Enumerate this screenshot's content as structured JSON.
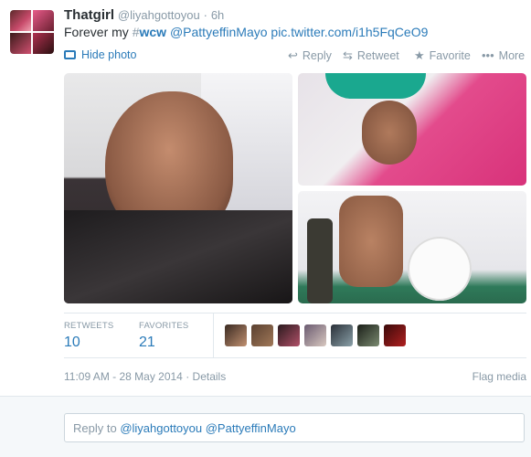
{
  "tweet": {
    "fullname": "Thatgirl",
    "handle": "@liyahgottoyou",
    "separator": "·",
    "time": "6h",
    "text_prefix": "Forever my ",
    "hashtag_hash": "#",
    "hashtag_word": "wcw",
    "mention": "@PattyeffinMayo",
    "link": "pic.twitter.com/i1h5FqCeO9"
  },
  "actions": {
    "hide_photo": "Hide photo",
    "reply": "Reply",
    "retweet": "Retweet",
    "favorite": "Favorite",
    "more": "More"
  },
  "icons": {
    "hide_photo": "photo-icon",
    "reply": "reply-arrow-icon",
    "retweet": "retweet-icon",
    "favorite": "star-icon",
    "more": "ellipsis-icon"
  },
  "stats": {
    "retweets_label": "RETWEETS",
    "retweets": "10",
    "favorites_label": "FAVORITES",
    "favorites": "21",
    "favoriter_count_shown": 7
  },
  "meta": {
    "timestamp": "11:09 AM - 28 May 2014",
    "separator": "·",
    "details": "Details",
    "flag": "Flag media"
  },
  "reply": {
    "prefix": "Reply to ",
    "mentions": "@liyahgottoyou @PattyeffinMayo"
  },
  "colors": {
    "link": "#2b7bb9",
    "muted": "#8899a6",
    "text": "#292f33",
    "border": "#e1e8ed",
    "reply_bg": "#f5f8fa"
  }
}
